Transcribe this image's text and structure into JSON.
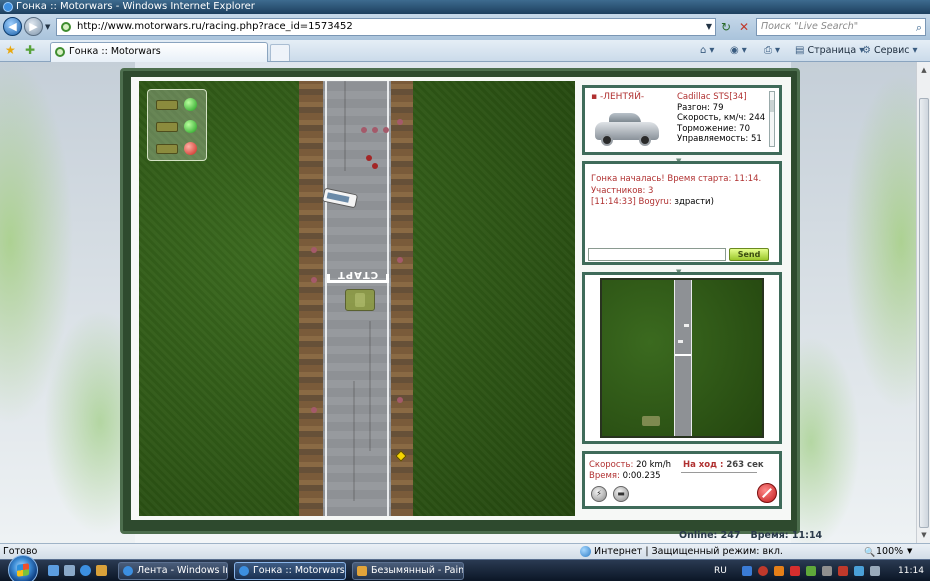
{
  "window": {
    "title": "Гонка :: Motorwars - Windows Internet Explorer"
  },
  "address": {
    "url": "http://www.motorwars.ru/racing.php?race_id=1573452",
    "search_placeholder": "Поиск \"Live Search\""
  },
  "tabs": [
    {
      "label": "Гонка :: Motorwars"
    }
  ],
  "commands": {
    "page": "Страница",
    "service": "Сервис"
  },
  "game": {
    "start_label": "СТАРТ",
    "car": {
      "player": "-ЛЕНТЯЙ-",
      "name": "Cadillac STS[34]",
      "stats": [
        {
          "label": "Разгон:",
          "value": "79"
        },
        {
          "label": "Скорость, км/ч:",
          "value": "244"
        },
        {
          "label": "Торможение:",
          "value": "70"
        },
        {
          "label": "Управляемость:",
          "value": "51"
        }
      ]
    },
    "chat": {
      "system_line1": "Гонка началась! Время старта: 11:14.",
      "system_line2": "Участников: 3",
      "message_time": "[11:14:33]",
      "message_user": "Bogyru:",
      "message_text": "здрасти)",
      "send_label": "Send"
    },
    "hud": {
      "speed_label": "Скорость:",
      "speed_value": "20 km/h",
      "time_label": "Время:",
      "time_value": "0:00.235",
      "turn_label": "На ход :",
      "turn_value": "263 сек"
    },
    "online_label": "Online:",
    "online_value": "247",
    "time_label": "Время:",
    "time_value": "11:14"
  },
  "status": {
    "ready": "Готово",
    "zone": "Интернет | Защищенный режим: вкл.",
    "zoom": "100%"
  },
  "taskbar": {
    "buttons": [
      {
        "label": "Лента - Windows In..."
      },
      {
        "label": "Гонка :: Motorwars ..."
      },
      {
        "label": "Безымянный - Paint"
      }
    ],
    "lang": "RU",
    "clock": "11:14"
  },
  "colors": {
    "accent_red": "#b03030",
    "panel_border": "#3f6b5a"
  }
}
